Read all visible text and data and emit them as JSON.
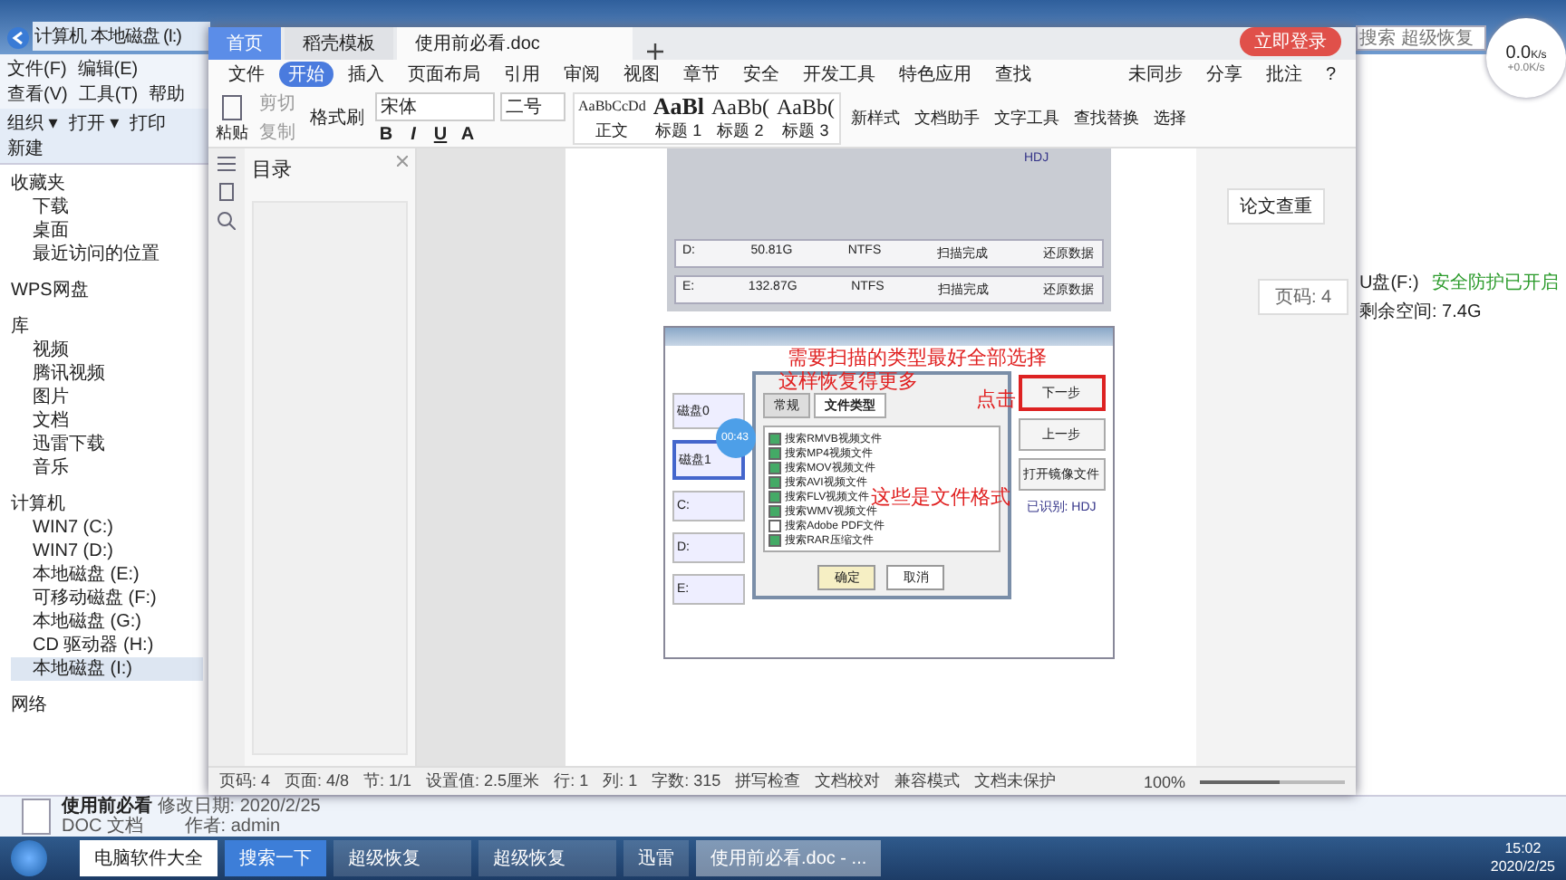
{
  "explorer": {
    "address": [
      "计算机",
      "本地磁盘 (I:)"
    ],
    "menu": [
      "文件(F)",
      "编辑(E)",
      "查看(V)",
      "工具(T)",
      "帮助"
    ],
    "toolbar": [
      "组织 ▾",
      "打开 ▾",
      "打印",
      "新建"
    ],
    "search": {
      "placeholder": "搜索 超级恢复"
    },
    "nav": [
      {
        "label": "收藏夹",
        "children": [
          {
            "label": "下载"
          },
          {
            "label": "桌面"
          },
          {
            "label": "最近访问的位置"
          }
        ]
      },
      {
        "label": "WPS网盘"
      },
      {
        "label": "库",
        "children": [
          {
            "label": "视频"
          },
          {
            "label": "腾讯视频"
          },
          {
            "label": "图片"
          },
          {
            "label": "文档"
          },
          {
            "label": "迅雷下载"
          },
          {
            "label": "音乐"
          }
        ]
      },
      {
        "label": "计算机",
        "children": [
          {
            "label": "WIN7 (C:)",
            "selected": false
          },
          {
            "label": "WIN7 (D:)",
            "selected": false
          },
          {
            "label": "本地磁盘 (E:)",
            "selected": false
          },
          {
            "label": "可移动磁盘 (F:)",
            "selected": false
          },
          {
            "label": "本地磁盘 (G:)",
            "selected": false
          },
          {
            "label": "CD 驱动器 (H:)",
            "selected": false
          },
          {
            "label": "本地磁盘 (I:)",
            "selected": true
          }
        ]
      },
      {
        "label": "网络"
      }
    ],
    "details": {
      "drive": "U盘(F:)",
      "security": "安全防护已开启",
      "free": "剩余空间: 7.4G"
    },
    "file_info": {
      "name": "使用前必看",
      "modified": "修改日期: 2020/2/25",
      "type": "DOC 文档",
      "author": "作者: admin"
    }
  },
  "speed": {
    "value": "0.0",
    "unit": "K/s",
    "sub": "+0.0K/s"
  },
  "wps": {
    "tabs": [
      {
        "label": "首页",
        "kind": "home",
        "selected": false
      },
      {
        "label": "稻壳模板",
        "kind": "template",
        "selected": false
      },
      {
        "label": "使用前必看.doc",
        "kind": "doc",
        "selected": true
      }
    ],
    "login": "立即登录",
    "ribbon_tabs": [
      {
        "label": "文件",
        "selected": false
      },
      {
        "label": "开始",
        "selected": true
      },
      {
        "label": "插入",
        "selected": false
      },
      {
        "label": "页面布局",
        "selected": false
      },
      {
        "label": "引用",
        "selected": false
      },
      {
        "label": "审阅",
        "selected": false
      },
      {
        "label": "视图",
        "selected": false
      },
      {
        "label": "章节",
        "selected": false
      },
      {
        "label": "安全",
        "selected": false
      },
      {
        "label": "开发工具",
        "selected": false
      },
      {
        "label": "特色应用",
        "selected": false
      },
      {
        "label": "查找",
        "selected": false
      }
    ],
    "ribbon_right": [
      "未同步",
      "分享",
      "批注",
      "?"
    ],
    "clipboard": {
      "paste": "粘贴",
      "cut": "剪切",
      "copy": "复制",
      "painter": "格式刷"
    },
    "font": "宋体",
    "size": "二号",
    "format_buttons": [
      "B",
      "I",
      "U",
      "A"
    ],
    "styles": [
      {
        "sample": "AaBbCcDd",
        "name": "正文"
      },
      {
        "sample": "AaBl",
        "name": "标题 1"
      },
      {
        "sample": "AaBb(",
        "name": "标题 2"
      },
      {
        "sample": "AaBb(",
        "name": "标题 3"
      }
    ],
    "tools": [
      "新样式",
      "文档助手",
      "文字工具",
      "查找替换",
      "选择"
    ],
    "toc_title": "目录",
    "side": {
      "button": "论文查重",
      "page": "页码: 4"
    },
    "doc_table": [
      [
        "D:",
        "50.81G",
        "NTFS",
        "扫描完成",
        "还原数据"
      ],
      [
        "E:",
        "132.87G",
        "NTFS",
        "扫描完成",
        "还原数据"
      ]
    ],
    "doc_tag": "HDJ",
    "shot": {
      "drives": [
        "磁盘0",
        "磁盘1",
        "C:",
        "D:",
        "E:"
      ],
      "dialog_tabs": [
        {
          "label": "常规",
          "selected": false
        },
        {
          "label": "文件类型",
          "selected": true
        }
      ],
      "types": [
        {
          "label": "搜索RMVB视频文件",
          "checked": true
        },
        {
          "label": "搜索MP4视频文件",
          "checked": true
        },
        {
          "label": "搜索MOV视频文件",
          "checked": true
        },
        {
          "label": "搜索AVI视频文件",
          "checked": true
        },
        {
          "label": "搜索FLV视频文件",
          "checked": true
        },
        {
          "label": "搜索WMV视频文件",
          "checked": true
        },
        {
          "label": "搜索Adobe PDF文件",
          "checked": false
        },
        {
          "label": "搜索RAR压缩文件",
          "checked": true
        }
      ],
      "ok": "确定",
      "cancel": "取消",
      "buttons": [
        "下一步",
        "上一步",
        "打开镜像文件"
      ],
      "recognized": "已识别: HDJ",
      "timer": "00:43",
      "notes": [
        "需要扫描的类型最好全部选择",
        "这样恢复得更多",
        "点击",
        "这些是文件格式"
      ]
    },
    "status": [
      "页码: 4",
      "页面: 4/8",
      "节: 1/1",
      "设置值: 2.5厘米",
      "行: 1",
      "列: 1",
      "字数: 315",
      "拼写检查",
      "文档校对",
      "兼容模式",
      "文档未保护"
    ],
    "zoom": {
      "label": "100%",
      "level": 0.55
    }
  },
  "taskbar": {
    "items": [
      {
        "label": "电脑软件大全",
        "kind": "search",
        "selected": false
      },
      {
        "label": "搜索一下",
        "kind": "button",
        "selected": false
      },
      {
        "label": "超级恢复",
        "kind": "folder",
        "selected": false
      },
      {
        "label": "超级恢复",
        "kind": "folder",
        "selected": false
      },
      {
        "label": "迅雷",
        "kind": "app",
        "selected": false
      },
      {
        "label": "使用前必看.doc - ...",
        "kind": "wps",
        "selected": true
      }
    ],
    "time": "15:02",
    "date": "2020/2/25"
  }
}
